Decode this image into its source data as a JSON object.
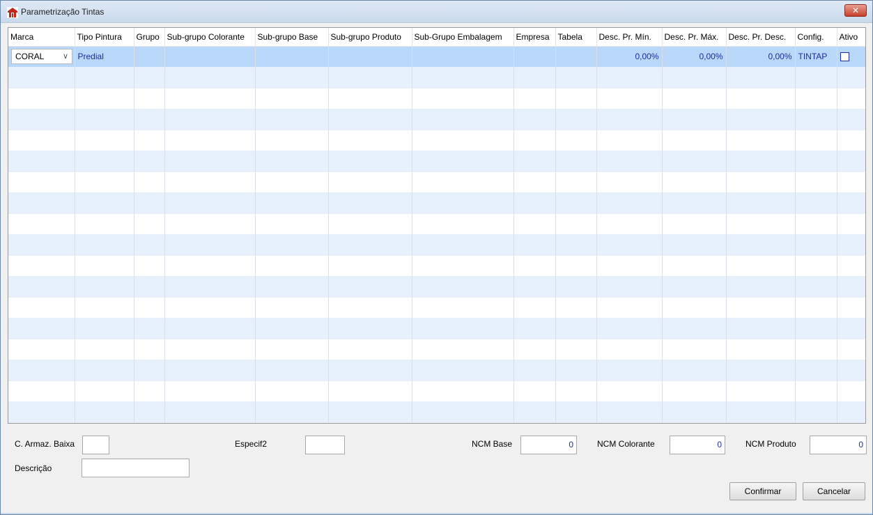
{
  "window": {
    "title": "Parametrização Tintas",
    "close_label": "✕"
  },
  "grid": {
    "columns": [
      "Marca",
      "Tipo Pintura",
      "Grupo",
      "Sub-grupo Colorante",
      "Sub-grupo Base",
      "Sub-grupo Produto",
      "Sub-Grupo Embalagem",
      "Empresa",
      "Tabela",
      "Desc. Pr. Mín.",
      "Desc. Pr. Máx.",
      "Desc. Pr. Desc.",
      "Config.",
      "Ativo"
    ],
    "rows": [
      {
        "marca": "CORAL",
        "tipo_pintura": "Predial",
        "grupo": "",
        "sub_grupo_colorante": "",
        "sub_grupo_base": "",
        "sub_grupo_produto": "",
        "sub_grupo_embalagem": "",
        "empresa": "",
        "tabela": "",
        "desc_min": "0,00%",
        "desc_max": "0,00%",
        "desc_desc": "0,00%",
        "config": "TINTAP",
        "ativo": false
      }
    ],
    "empty_rows": 17
  },
  "form": {
    "c_armaz_baixa_label": "C. Armaz. Baixa",
    "c_armaz_baixa_value": "",
    "especif2_label": "Especif2",
    "especif2_value": "",
    "ncm_base_label": "NCM Base",
    "ncm_base_value": "0",
    "ncm_colorante_label": "NCM Colorante",
    "ncm_colorante_value": "0",
    "ncm_produto_label": "NCM Produto",
    "ncm_produto_value": "0",
    "descricao_label": "Descrição",
    "descricao_value": ""
  },
  "buttons": {
    "confirmar": "Confirmar",
    "cancelar": "Cancelar"
  },
  "colors": {
    "selected_row": "#b9d7f8",
    "alt_row": "#e7f1fd",
    "value_text": "#1a2ea0",
    "app_icon": "#c0281c"
  }
}
